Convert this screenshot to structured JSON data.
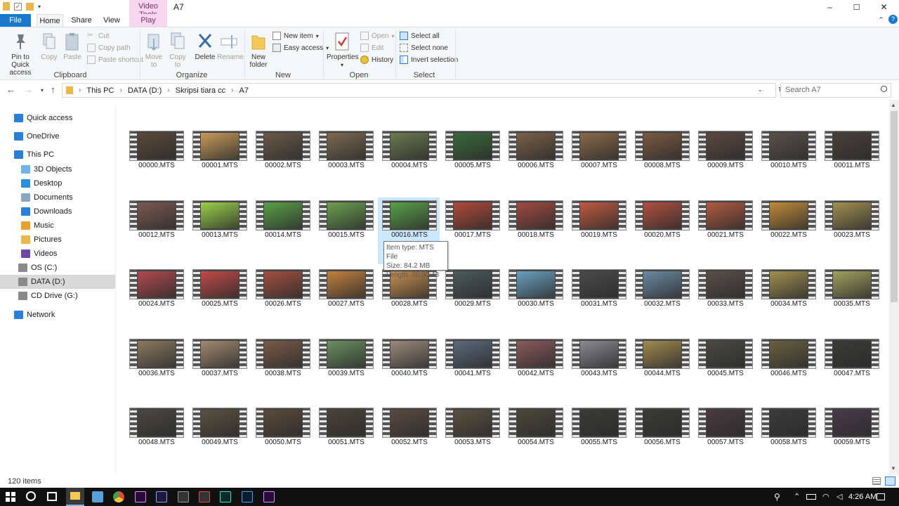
{
  "window": {
    "title": "A7",
    "context_tab_label": "Video Tools",
    "controls": [
      "–",
      "☐",
      "✕"
    ]
  },
  "ribbon_tabs": [
    "File",
    "Home",
    "Share",
    "View",
    "Play"
  ],
  "ribbon_groups": {
    "clipboard": {
      "label": "Clipboard",
      "pin": "Pin to Quick access",
      "copy": "Copy",
      "paste": "Paste",
      "cut": "Cut",
      "copy_path": "Copy path",
      "paste_shortcut": "Paste shortcut"
    },
    "organize": {
      "label": "Organize",
      "move_to": "Move to",
      "copy_to": "Copy to",
      "delete": "Delete",
      "rename": "Rename"
    },
    "new": {
      "label": "New",
      "new_folder": "New folder",
      "new_item": "New item",
      "easy_access": "Easy access"
    },
    "open": {
      "label": "Open",
      "properties": "Properties",
      "open": "Open",
      "edit": "Edit",
      "history": "History"
    },
    "select": {
      "label": "Select",
      "select_all": "Select all",
      "select_none": "Select none",
      "invert": "Invert selection"
    }
  },
  "address": {
    "crumbs": [
      "This PC",
      "DATA (D:)",
      "Skripsi tiara cc",
      "A7"
    ],
    "search_placeholder": "Search A7"
  },
  "nav_pane": [
    {
      "label": "Quick access",
      "icon": "star-icon",
      "color": "#2a7fd4"
    },
    {
      "label": "OneDrive",
      "icon": "cloud-icon",
      "color": "#2a7fd4"
    },
    {
      "label": "This PC",
      "icon": "computer-icon",
      "color": "#2a7fd4"
    },
    {
      "label": "3D Objects",
      "icon": "cube-icon",
      "color": "#6fb3e8"
    },
    {
      "label": "Desktop",
      "icon": "desktop-icon",
      "color": "#2a8fd8"
    },
    {
      "label": "Documents",
      "icon": "documents-icon",
      "color": "#8aa7c2"
    },
    {
      "label": "Downloads",
      "icon": "download-icon",
      "color": "#2a7fd4"
    },
    {
      "label": "Music",
      "icon": "music-icon",
      "color": "#e8a12c"
    },
    {
      "label": "Pictures",
      "icon": "pictures-icon",
      "color": "#e8b84c"
    },
    {
      "label": "Videos",
      "icon": "videos-icon",
      "color": "#6b4aa8"
    },
    {
      "label": "OS (C:)",
      "icon": "drive-icon",
      "color": "#8a8a8a"
    },
    {
      "label": "DATA (D:)",
      "icon": "drive-icon",
      "color": "#8a8a8a"
    },
    {
      "label": "CD Drive (G:)",
      "icon": "cd-drive-icon",
      "color": "#8a8a8a"
    },
    {
      "label": "Network",
      "icon": "network-icon",
      "color": "#2a7fd4"
    }
  ],
  "files": [
    "00000.MTS",
    "00001.MTS",
    "00002.MTS",
    "00003.MTS",
    "00004.MTS",
    "00005.MTS",
    "00006.MTS",
    "00007.MTS",
    "00008.MTS",
    "00009.MTS",
    "00010.MTS",
    "00011.MTS",
    "00012.MTS",
    "00013.MTS",
    "00014.MTS",
    "00015.MTS",
    "00016.MTS",
    "00017.MTS",
    "00018.MTS",
    "00019.MTS",
    "00020.MTS",
    "00021.MTS",
    "00022.MTS",
    "00023.MTS",
    "00024.MTS",
    "00025.MTS",
    "00026.MTS",
    "00027.MTS",
    "00028.MTS",
    "00029.MTS",
    "00030.MTS",
    "00031.MTS",
    "00032.MTS",
    "00033.MTS",
    "00034.MTS",
    "00035.MTS",
    "00036.MTS",
    "00037.MTS",
    "00038.MTS",
    "00039.MTS",
    "00040.MTS",
    "00041.MTS",
    "00042.MTS",
    "00043.MTS",
    "00044.MTS",
    "00045.MTS",
    "00046.MTS",
    "00047.MTS",
    "00048.MTS",
    "00049.MTS",
    "00050.MTS",
    "00051.MTS",
    "00052.MTS",
    "00053.MTS",
    "00054.MTS",
    "00055.MTS",
    "00056.MTS",
    "00057.MTS",
    "00058.MTS",
    "00059.MTS"
  ],
  "thumb_colors": [
    "#5a4a3a",
    "#c89a5a",
    "#6a5a48",
    "#7a6a50",
    "#6a7a50",
    "#3a6a3a",
    "#7a6048",
    "#8a6a48",
    "#7a5a40",
    "#5a4a40",
    "#5a5048",
    "#4a4038",
    "#7a5a50",
    "#9ad04a",
    "#5aa048",
    "#6aa050",
    "#5aa04a",
    "#b04a3a",
    "#a04a40",
    "#c05a40",
    "#b05040",
    "#b05a40",
    "#c08a3a",
    "#a09050",
    "#b04a50",
    "#c04a48",
    "#a05040",
    "#c08040",
    "#c89050",
    "#4a5a5a",
    "#6aa0c0",
    "#4a4a4a",
    "#6a8aa0",
    "#5a5048",
    "#a09050",
    "#a0a060",
    "#8a7a60",
    "#a08a70",
    "#7a5a48",
    "#6a9060",
    "#9a8a7a",
    "#5a6a7a",
    "#8a5a5a",
    "#8a8a90",
    "#a08a50",
    "#4a4a40",
    "#6a6040",
    "#3a3a38",
    "#4a4840",
    "#5a5040",
    "#5a4a3a",
    "#4a4438",
    "#5a4a40",
    "#5a5040",
    "#4a4838",
    "#3a3a38",
    "#3a3a38",
    "#4a3a40",
    "#3a3a3a",
    "#4a3a48"
  ],
  "selected_file": "00016.MTS",
  "tooltip": {
    "type": "Item type: MTS File",
    "size": "Size: 84.2 MB",
    "length": "Length: 00:00:43"
  },
  "status": {
    "count": "120 items"
  },
  "taskbar": {
    "time": "4:26 AM"
  }
}
